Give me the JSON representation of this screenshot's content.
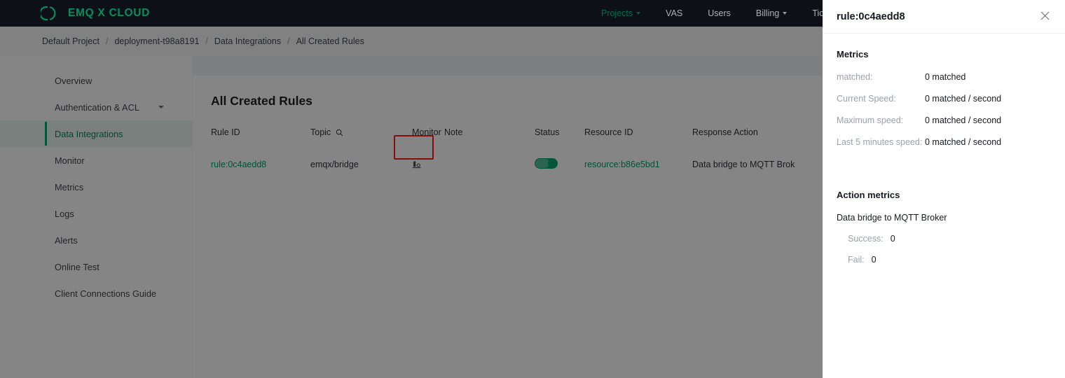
{
  "topnav": {
    "brand": "EMQ X CLOUD",
    "brand_color": "#00b173",
    "items": [
      {
        "label": "Projects",
        "caret": true,
        "active": true
      },
      {
        "label": "VAS",
        "caret": false,
        "active": false
      },
      {
        "label": "Users",
        "caret": false,
        "active": false
      },
      {
        "label": "Billing",
        "caret": true,
        "active": false
      },
      {
        "label": "Tic",
        "caret": false,
        "active": false
      }
    ]
  },
  "breadcrumb": {
    "items": [
      "Default Project",
      "deployment-t98a8191",
      "Data Integrations",
      "All Created Rules"
    ],
    "separator": "/"
  },
  "sidebar": {
    "items": [
      {
        "label": "Overview",
        "active": false,
        "caret": false
      },
      {
        "label": "Authentication & ACL",
        "active": false,
        "caret": true
      },
      {
        "label": "Data Integrations",
        "active": true,
        "caret": false
      },
      {
        "label": "Monitor",
        "active": false,
        "caret": false
      },
      {
        "label": "Metrics",
        "active": false,
        "caret": false
      },
      {
        "label": "Logs",
        "active": false,
        "caret": false
      },
      {
        "label": "Alerts",
        "active": false,
        "caret": false
      },
      {
        "label": "Online Test",
        "active": false,
        "caret": false
      },
      {
        "label": "Client Connections Guide",
        "active": false,
        "caret": false
      }
    ],
    "active_color": "#00895c"
  },
  "main": {
    "title": "All Created Rules",
    "table": {
      "columns": [
        "Rule ID",
        "Topic",
        "Monitor",
        "Note",
        "Status",
        "Resource ID",
        "Response Action"
      ],
      "topic_has_search_icon": true,
      "rows": [
        {
          "rule_id": "rule:0c4aedd8",
          "topic": "emqx/bridge",
          "monitor_icon": "monitor-chart-icon",
          "note": "",
          "status_on": true,
          "resource_id": "resource:b86e5bd1",
          "response_action": "Data bridge to MQTT Brok"
        }
      ]
    },
    "highlight_color": "#fa1e1e"
  },
  "drawer": {
    "title": "rule:0c4aedd8",
    "close_label": "×",
    "metrics_section_title": "Metrics",
    "metrics": [
      {
        "key": "matched:",
        "value": "0 matched"
      },
      {
        "key": "Current Speed:",
        "value": "0 matched / second"
      },
      {
        "key": "Maximum speed:",
        "value": "0 matched / second"
      },
      {
        "key": "Last 5 minutes speed:",
        "value": "0 matched / second"
      }
    ],
    "action_section_title": "Action metrics",
    "action_name": "Data bridge to MQTT Broker",
    "action_metrics": [
      {
        "key": "Success:",
        "value": "0"
      },
      {
        "key": "Fail:",
        "value": "0"
      }
    ]
  }
}
